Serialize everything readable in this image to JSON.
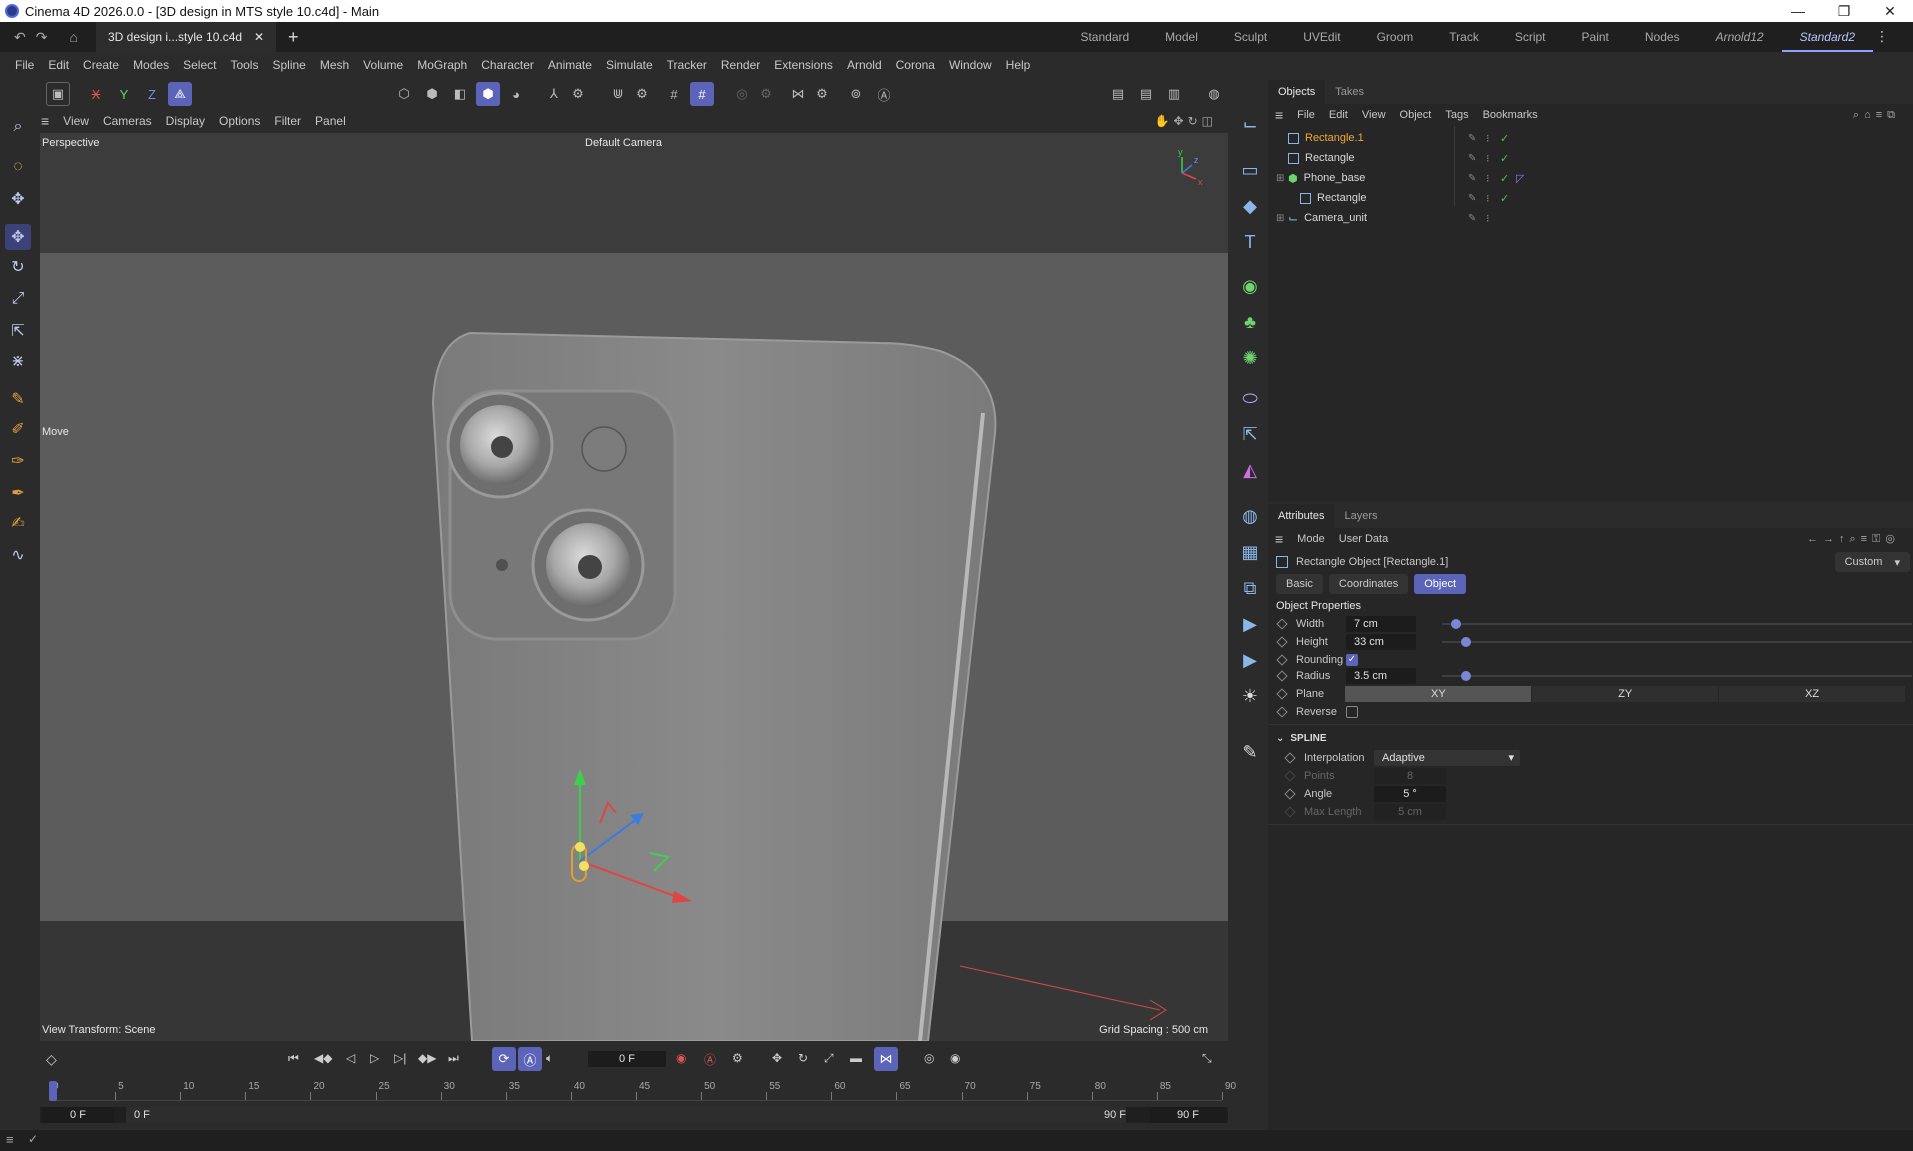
{
  "window": {
    "title": "Cinema 4D 2026.0.0 - [3D design in MTS style 10.c4d] - Main",
    "minimize": "—",
    "maximize": "❐",
    "close": "✕"
  },
  "tabbar": {
    "document_tab": "3D design i...style 10.c4d",
    "close_tab": "✕",
    "new_tab": "+",
    "layouts": [
      "Standard",
      "Model",
      "Sculpt",
      "UVEdit",
      "Groom",
      "Track",
      "Script",
      "Paint",
      "Nodes",
      "Arnold12",
      "Standard2"
    ],
    "active_layout": "Standard2",
    "more": "⋮"
  },
  "menu": [
    "File",
    "Edit",
    "Create",
    "Modes",
    "Select",
    "Tools",
    "Spline",
    "Mesh",
    "Volume",
    "MoGraph",
    "Character",
    "Animate",
    "Simulate",
    "Tracker",
    "Render",
    "Extensions",
    "Arnold",
    "Corona",
    "Window",
    "Help"
  ],
  "axis_toggles": {
    "x": "X",
    "y": "Y",
    "z": "Z"
  },
  "viewport_menu": [
    "View",
    "Cameras",
    "Display",
    "Options",
    "Filter",
    "Panel"
  ],
  "viewport": {
    "projection": "Perspective",
    "camera": "Default Camera",
    "tool_label": "Move",
    "view_transform": "View Transform: Scene",
    "grid_spacing": "Grid Spacing : 500 cm"
  },
  "objects_panel": {
    "tabs": [
      "Objects",
      "Takes"
    ],
    "active_tab": "Objects",
    "menu": [
      "File",
      "Edit",
      "View",
      "Object",
      "Tags",
      "Bookmarks"
    ],
    "items": [
      {
        "name": "Rectangle.1",
        "selected": true
      },
      {
        "name": "Rectangle"
      },
      {
        "name": "Phone_base"
      },
      {
        "name": "Rectangle"
      },
      {
        "name": "Camera_unit"
      }
    ]
  },
  "attributes_panel": {
    "tabs": [
      "Attributes",
      "Layers"
    ],
    "active_tab": "Attributes",
    "menu": [
      "Mode",
      "User Data"
    ],
    "object_title": "Rectangle Object [Rectangle.1]",
    "preset": "Custom",
    "sub_tabs": [
      "Basic",
      "Coordinates",
      "Object"
    ],
    "active_sub_tab": "Object",
    "section_title": "Object Properties",
    "width_label": "Width",
    "width_value": "7 cm",
    "width_level": 0.02,
    "height_label": "Height",
    "height_value": "33 cm",
    "height_level": 0.04,
    "rounding_label": "Rounding",
    "rounding_checked": true,
    "radius_label": "Radius",
    "radius_value": "3.5 cm",
    "radius_level": 0.04,
    "plane_label": "Plane",
    "plane_options": [
      "XY",
      "ZY",
      "XZ"
    ],
    "plane_selected": "XY",
    "reverse_label": "Reverse",
    "reverse_checked": false,
    "spline_section": "SPLINE",
    "interpolation_label": "Interpolation",
    "interpolation_value": "Adaptive",
    "points_label": "Points",
    "points_value": "8",
    "angle_label": "Angle",
    "angle_value": "5 °",
    "maxlength_label": "Max Length",
    "maxlength_value": "5 cm"
  },
  "timeline": {
    "current_frame": "0 F",
    "ruler_labels": [
      "0",
      "5",
      "10",
      "15",
      "20",
      "25",
      "30",
      "35",
      "40",
      "45",
      "50",
      "55",
      "60",
      "65",
      "70",
      "75",
      "80",
      "85",
      "90"
    ],
    "range_start": "0 F",
    "range_start2": "0 F",
    "range_end": "90 F",
    "range_end2": "90 F"
  },
  "colors": {
    "accent": "#5b64b8",
    "selected_text": "#f2a83b",
    "check_green": "#4fc64f"
  }
}
